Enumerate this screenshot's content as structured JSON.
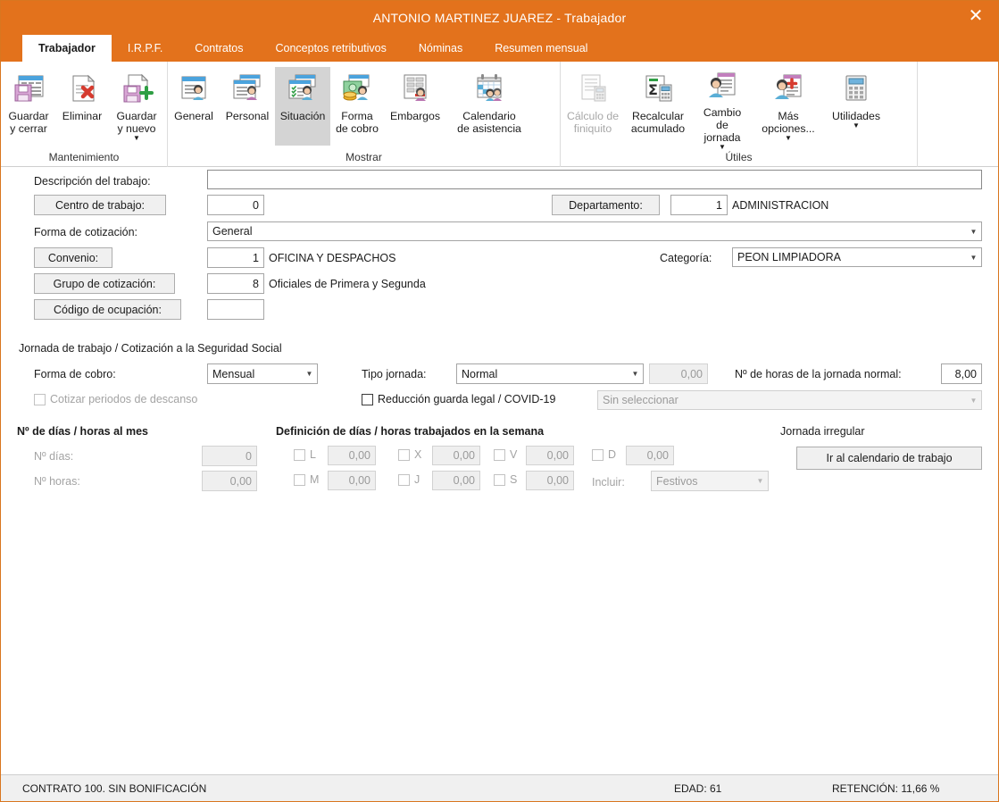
{
  "window": {
    "title": "ANTONIO MARTINEZ JUAREZ - Trabajador",
    "close_label": "✕",
    "accent_color": "#e3721c"
  },
  "tabs": [
    {
      "label": "Trabajador",
      "active": true
    },
    {
      "label": "I.R.P.F.",
      "active": false
    },
    {
      "label": "Contratos",
      "active": false
    },
    {
      "label": "Conceptos retributivos",
      "active": false
    },
    {
      "label": "Nóminas",
      "active": false
    },
    {
      "label": "Resumen mensual",
      "active": false
    }
  ],
  "ribbon": {
    "groups": [
      {
        "label": "Mantenimiento",
        "buttons": [
          {
            "label": "Guardar\ny cerrar",
            "icon": "save-close-icon",
            "state": "normal",
            "caret": false
          },
          {
            "label": "Eliminar",
            "icon": "delete-document-icon",
            "state": "normal",
            "caret": false
          },
          {
            "label": "Guardar\ny nuevo",
            "icon": "save-new-icon",
            "state": "normal",
            "caret": true
          }
        ]
      },
      {
        "label": "Mostrar",
        "buttons": [
          {
            "label": "General",
            "icon": "general-card-icon",
            "state": "normal",
            "caret": false
          },
          {
            "label": "Personal",
            "icon": "personal-card-icon",
            "state": "normal",
            "caret": false
          },
          {
            "label": "Situación",
            "icon": "situacion-card-icon",
            "state": "selected",
            "caret": false
          },
          {
            "label": "Forma\nde cobro",
            "icon": "money-exchange-icon",
            "state": "normal",
            "caret": false
          },
          {
            "label": "Embargos",
            "icon": "embargos-icon",
            "state": "normal",
            "caret": false
          },
          {
            "label": "Calendario\nde asistencia",
            "icon": "attendance-calendar-icon",
            "state": "normal",
            "caret": false
          }
        ]
      },
      {
        "label": "Útiles",
        "buttons": [
          {
            "label": "Cálculo de\nfiniquito",
            "icon": "settlement-calc-icon",
            "state": "disabled",
            "caret": false
          },
          {
            "label": "Recalcular\nacumulado",
            "icon": "sum-calculator-icon",
            "state": "normal",
            "caret": false
          },
          {
            "label": "Cambio de\njornada",
            "icon": "change-shift-icon",
            "state": "normal",
            "caret": true
          },
          {
            "label": "Más\nopciones...",
            "icon": "more-options-icon",
            "state": "normal",
            "caret": true
          },
          {
            "label": "Utilidades",
            "icon": "calculator-icon",
            "state": "normal",
            "caret": true
          }
        ]
      }
    ]
  },
  "form": {
    "descripcion_label": "Descripción del trabajo:",
    "descripcion_value": "",
    "centro_button": "Centro de trabajo:",
    "centro_value": "0",
    "departamento_button": "Departamento:",
    "departamento_value": "1",
    "departamento_text": "ADMINISTRACION",
    "forma_cotizacion_label": "Forma de cotización:",
    "forma_cotizacion_value": "General",
    "convenio_button": "Convenio:",
    "convenio_value": "1",
    "convenio_text": "OFICINA Y DESPACHOS",
    "categoria_label": "Categoría:",
    "categoria_value": "PEON LIMPIADORA",
    "grupo_button": "Grupo de cotización:",
    "grupo_value": "8",
    "grupo_text": "Oficiales de Primera y Segunda",
    "ocupacion_button": "Código de ocupación:",
    "ocupacion_value": ""
  },
  "jornada": {
    "section_title": "Jornada de trabajo / Cotización a la Seguridad Social",
    "forma_cobro_label": "Forma de cobro:",
    "forma_cobro_value": "Mensual",
    "cotizar_descanso_label": "Cotizar periodos de descanso",
    "cotizar_descanso_checked": false,
    "tipo_jornada_label": "Tipo jornada:",
    "tipo_jornada_value": "Normal",
    "tipo_jornada_num": "0,00",
    "horas_normal_label": "Nº de horas de la jornada normal:",
    "horas_normal_value": "8,00",
    "reduccion_label": "Reducción guarda legal / COVID-19",
    "reduccion_checked": false,
    "reduccion_value": "Sin seleccionar"
  },
  "mes": {
    "section_title": "Nº de días / horas al mes",
    "dias_label": "Nº días:",
    "dias_value": "0",
    "horas_label": "Nº horas:",
    "horas_value": "0,00"
  },
  "semana": {
    "section_title": "Definición de días / horas trabajados en la semana",
    "days": [
      {
        "code": "L",
        "value": "0,00",
        "checked": false
      },
      {
        "code": "M",
        "value": "0,00",
        "checked": false
      },
      {
        "code": "X",
        "value": "0,00",
        "checked": false
      },
      {
        "code": "J",
        "value": "0,00",
        "checked": false
      },
      {
        "code": "V",
        "value": "0,00",
        "checked": false
      },
      {
        "code": "S",
        "value": "0,00",
        "checked": false
      },
      {
        "code": "D",
        "value": "0,00",
        "checked": false
      }
    ],
    "incluir_label": "Incluir:",
    "incluir_value": "Festivos"
  },
  "irregular": {
    "section_title": "Jornada irregular",
    "button_label": "Ir al calendario de trabajo"
  },
  "statusbar": {
    "contrato": "CONTRATO 100.  SIN BONIFICACIÓN",
    "edad": "EDAD: 61",
    "retencion": "RETENCIÓN: 11,66 %"
  }
}
